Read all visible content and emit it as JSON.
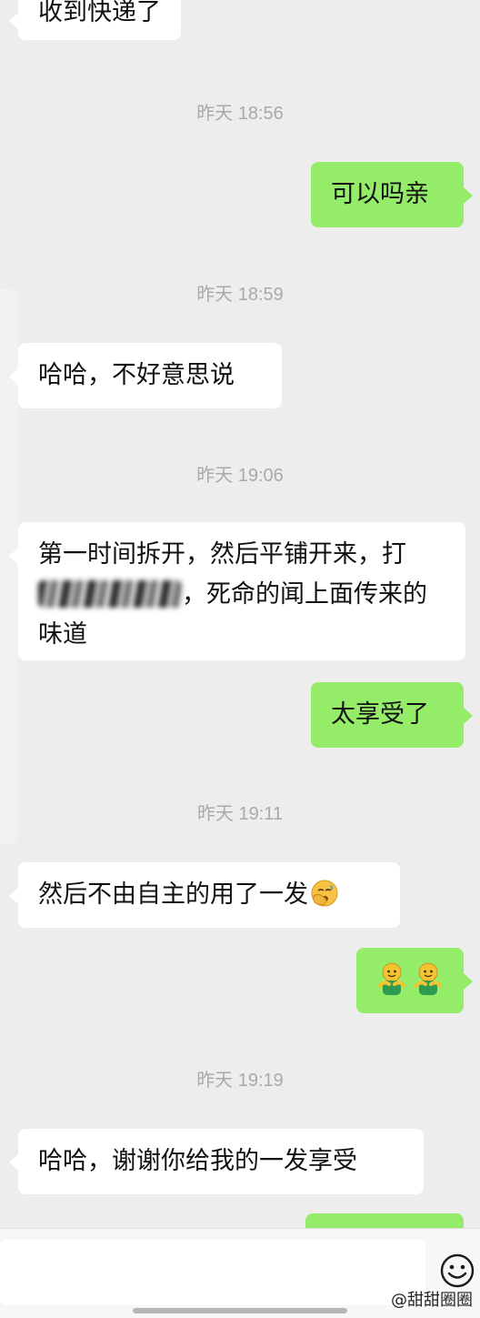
{
  "messages": {
    "m1": "收到快递了",
    "ts1": "昨天 18:56",
    "m2": "可以吗亲",
    "ts2": "昨天 18:59",
    "m3": "哈哈，不好意思说",
    "ts3": "昨天 19:06",
    "m4_line1": "第一时间拆开，然后平铺开来，打",
    "m4_line2": "，死命的闻上面传来的",
    "m4_line3": "味道",
    "m5": "太享受了",
    "ts4": "昨天 19:11",
    "m6": "然后不由自主的用了一发",
    "ts5": "昨天 19:19",
    "m8": "哈哈，谢谢你给我的一发享受"
  },
  "icons": {
    "face_palm": "face-palm-emoji",
    "hugging_figures": "hug-emoji",
    "emoji_button": "smiley-icon"
  },
  "colors": {
    "background": "#ededed",
    "received_bubble": "#ffffff",
    "sent_bubble": "#95ec69",
    "timestamp": "#a9a9a9"
  },
  "watermark": "@甜甜圈圈"
}
